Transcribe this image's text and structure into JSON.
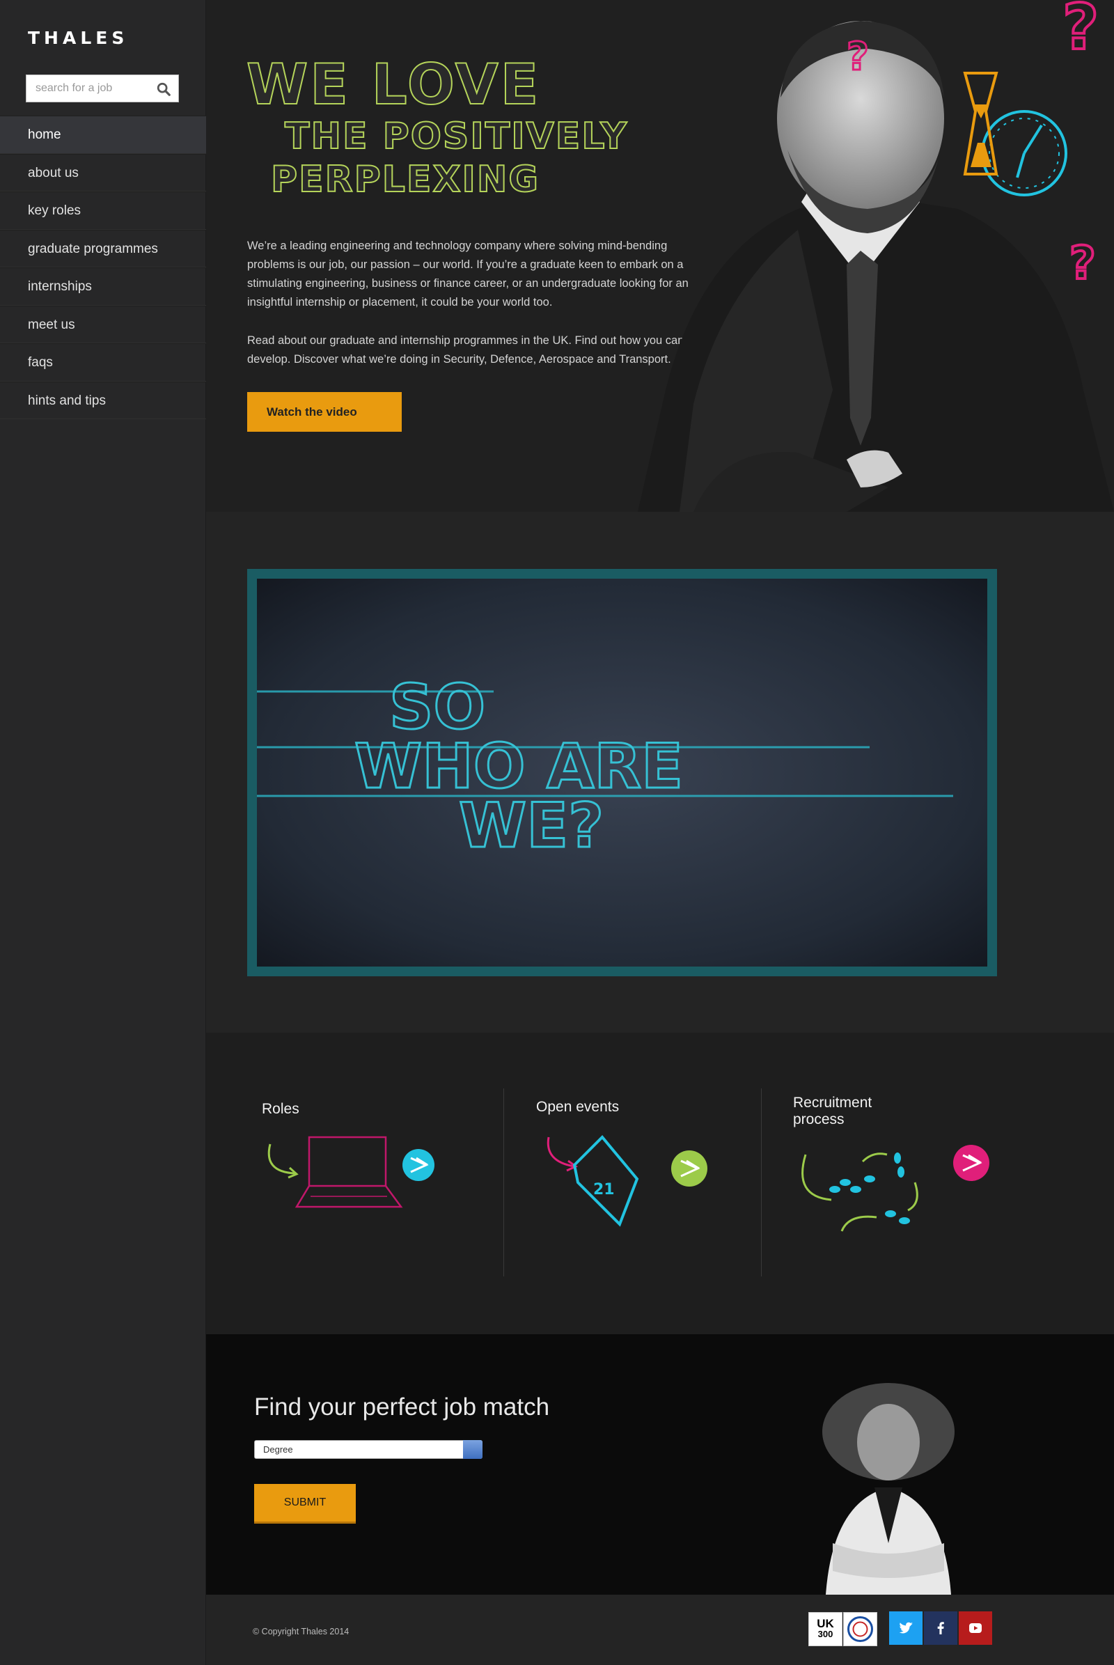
{
  "brand": {
    "logo": "THALES"
  },
  "search": {
    "placeholder": "search for a job"
  },
  "nav": {
    "items": [
      {
        "label": "home",
        "active": true
      },
      {
        "label": "about us"
      },
      {
        "label": "key roles"
      },
      {
        "label": "graduate programmes"
      },
      {
        "label": "internships"
      },
      {
        "label": "meet us"
      },
      {
        "label": "faqs"
      },
      {
        "label": "hints and tips"
      }
    ]
  },
  "hero": {
    "title_line1": "WE LOVE",
    "title_line2": "THE POSITIVELY",
    "title_line3": "PERPLEXING",
    "paragraph1": "We’re a leading engineering and technology company where solving mind-bending problems is our job, our passion – our world. If you’re a graduate keen to embark on a stimulating engineering, business or finance career, or an undergraduate looking for an insightful internship or placement, it could be your world too.",
    "paragraph2": "Read about our graduate and internship programmes in the UK. Find out how you can develop. Discover what we’re doing in Security, Defence, Aerospace and Transport.",
    "video_button": "Watch the video"
  },
  "video": {
    "line1": "SO",
    "line2": "WHO ARE",
    "line3": "WE?"
  },
  "features": [
    {
      "title": "Roles",
      "arrow_color": "#22c3e0"
    },
    {
      "title": "Open events",
      "arrow_color": "#9ccb4a"
    },
    {
      "title": "Recruitment process",
      "arrow_color": "#e01f7a"
    }
  ],
  "calendar_day": "21",
  "match": {
    "title": "Find your perfect job match",
    "select_value": "Degree",
    "submit": "SUBMIT"
  },
  "footer": {
    "copyright": "© Copyright Thales 2014",
    "badge_uk_top": "UK",
    "badge_uk_bottom": "300",
    "social": [
      {
        "icon": "twitter-icon",
        "color": "#1da1f2"
      },
      {
        "icon": "facebook-icon",
        "color": "#23335e"
      },
      {
        "icon": "youtube-icon",
        "color": "#b71c1c"
      }
    ]
  },
  "colors": {
    "accent": "#e99b0f",
    "chalk_green": "#b5d45a",
    "chalk_blue": "#22c3e0",
    "chalk_pink": "#e01f7a"
  }
}
